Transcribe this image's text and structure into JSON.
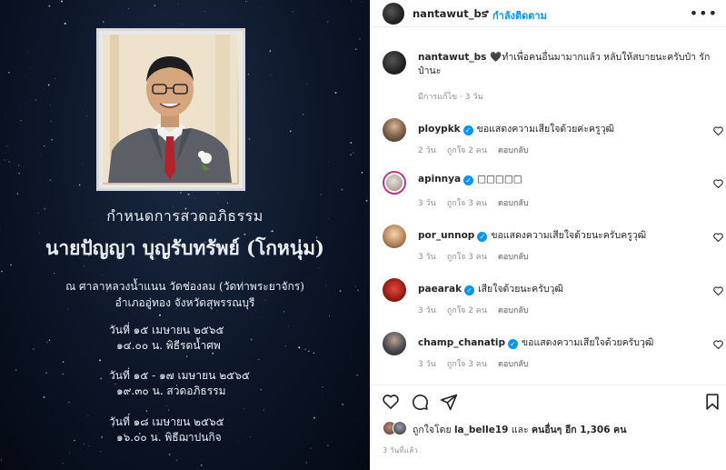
{
  "image": {
    "heading": "กำหนดการสวดอภิธรรม",
    "name": "นายปัญญา บุญรับทรัพย์ (โกหนุ่ม)",
    "venue_line1": "ณ ศาลาหลวงน้ำแนน วัดช่องลม (วัดท่าพระยาจักร)",
    "venue_line2": "อำเภออู่ทอง จังหวัดสุพรรณบุรี",
    "schedule": [
      {
        "date": "วันที่ ๑๕ เมษายน ๒๕๖๕",
        "detail": "๑๔.๐๐ น. พิธีรดน้ำศพ"
      },
      {
        "date": "วันที่ ๑๕ - ๑๗ เมษายน ๒๕๖๕",
        "detail": "๑๙.๓๐ น. สวดอภิธรรม"
      },
      {
        "date": "วันที่ ๑๘ เมษายน ๒๕๖๕",
        "detail": "๑๖.๐๐ น. พิธีฌาปนกิจ"
      }
    ]
  },
  "header": {
    "username": "nantawut_bs",
    "dot": "•",
    "follow_label": "กำลังติดตาม",
    "more_icon": "more-horizontal-icon"
  },
  "caption": {
    "username": "nantawut_bs",
    "text": "🖤ทำเพื่อคนอื่นมามากแล้ว หลับให้สบายนะครับป๋า รักป๋านะ",
    "meta": "มีการแก้ไข · 3 วัน"
  },
  "comments": [
    {
      "username": "ploypkk",
      "text": "ขอแสดงความเสียใจด้วยค่ะครูวุฒิ",
      "time": "2 วัน",
      "likes": "ถูกใจ 2 คน",
      "reply": "ตอบกลับ"
    },
    {
      "username": "apinnya",
      "text": "□□□□□",
      "time": "3 วัน",
      "likes": "ถูกใจ 3 คน",
      "reply": "ตอบกลับ"
    },
    {
      "username": "por_unnop",
      "text": "ขอแสดงความเสียใจด้วยนะครับครูวุฒิ",
      "time": "3 วัน",
      "likes": "ถูกใจ 3 คน",
      "reply": "ตอบกลับ"
    },
    {
      "username": "paearak",
      "text": "เสียใจด้วยนะครับวุฒิ",
      "time": "3 วัน",
      "likes": "ถูกใจ 2 คน",
      "reply": "ตอบกลับ"
    },
    {
      "username": "champ_chanatip",
      "text": "ขอแสดงความเสียใจด้วยครับวุฒิ",
      "time": "3 วัน",
      "likes": "ถูกใจ 3 คน",
      "reply": "ตอบกลับ"
    }
  ],
  "likes": {
    "prefix": "ถูกใจโดย",
    "user": "la_belle19",
    "middle": "และ",
    "others": "คนอื่นๆ อีก 1,306 คน"
  },
  "time_ago": "3 วันที่แล้ว",
  "colors": {
    "accent": "#0095f6",
    "text": "#262626",
    "muted": "#8e8e8e"
  }
}
